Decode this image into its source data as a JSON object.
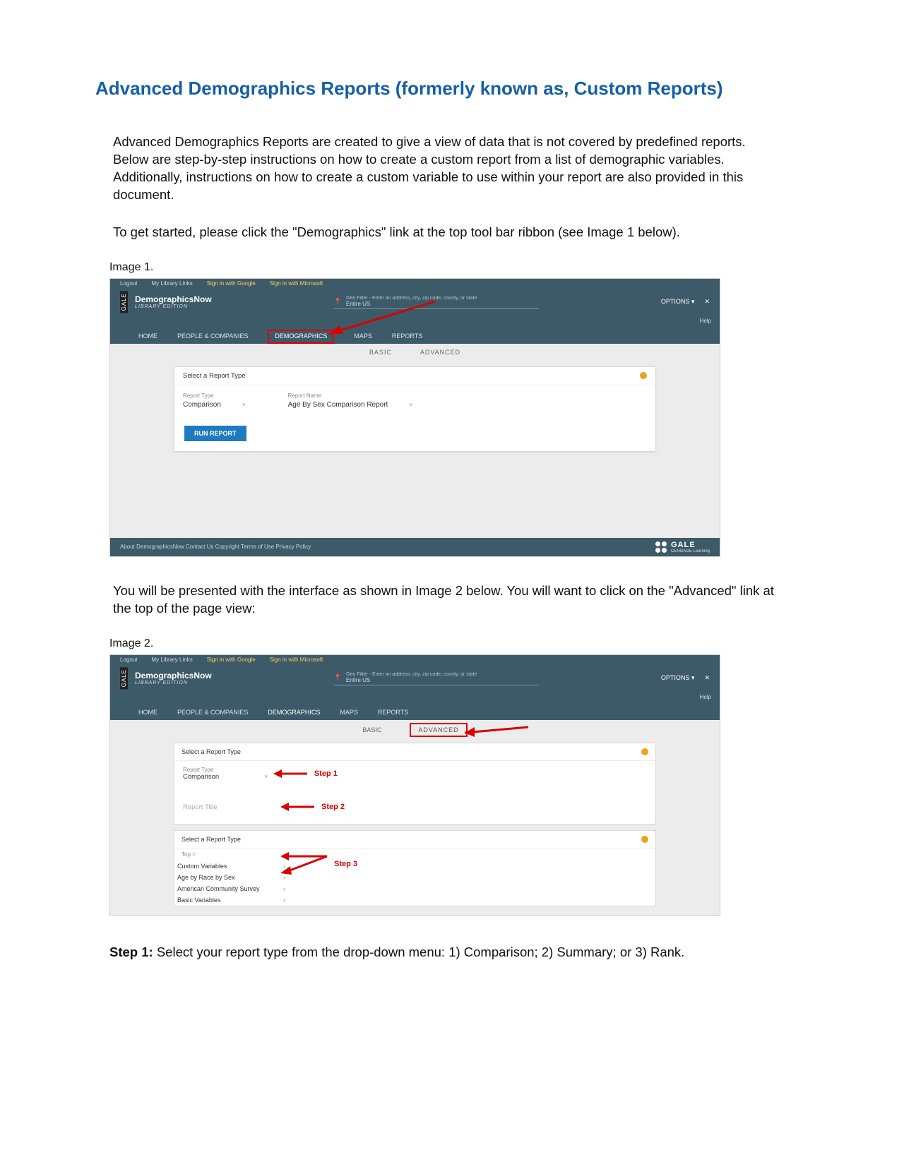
{
  "title": "Advanced Demographics Reports (formerly known as, Custom Reports)",
  "intro1": "Advanced Demographics Reports are created to give a view of data that is not covered by predefined reports. Below are step-by-step instructions on how to create a custom report from a list of demographic variables. Additionally, instructions on how to create a custom variable to use within your report are also provided in this document.",
  "intro2": "To get started, please click the \"Demographics\" link at the top tool bar ribbon (see Image 1 below).",
  "image1_label": "Image 1.",
  "shot1": {
    "topbar": {
      "logout": "Logout",
      "links": "My Library Links",
      "google": "Sign in with Google",
      "ms": "Sign in with Microsoft"
    },
    "brand": {
      "gale": "GALE",
      "name": "DemographicsNow",
      "edition": "LIBRARY EDITION"
    },
    "geo": {
      "hint": "Geo Filter - Enter an address, city, zip code, county, or state",
      "value": "Entire US"
    },
    "options": "OPTIONS ▾",
    "close": "✕",
    "help": "Help",
    "tabs": {
      "home": "HOME",
      "pc": "PEOPLE & COMPANIES",
      "demo": "DEMOGRAPHICS",
      "maps": "MAPS",
      "reports": "REPORTS"
    },
    "subtabs": {
      "basic": "BASIC",
      "advanced": "ADVANCED"
    },
    "panel": {
      "hdr": "Select a Report Type",
      "rt_label": "Report Type",
      "rt_value": "Comparison",
      "rn_label": "Report Name",
      "rn_value": "Age By Sex Comparison Report",
      "run": "RUN REPORT"
    },
    "footer": {
      "links": "About DemographicsNow    Contact Us    Copyright    Terms of Use    Privacy Policy",
      "gale": "GALE",
      "cengage": "CENGAGE Learning"
    }
  },
  "mid_para": "You will be presented with the interface as shown in Image 2 below.  You will want to click on the \"Advanced\" link at the top of the page view:",
  "image2_label": "Image 2.",
  "shot2": {
    "topbar": {
      "logout": "Logout",
      "links": "My Library Links",
      "google": "Sign in with Google",
      "ms": "Sign in with Microsoft"
    },
    "brand": {
      "gale": "GALE",
      "name": "DemographicsNow",
      "edition": "LIBRARY EDITION"
    },
    "geo": {
      "hint": "Geo Filter - Enter an address, city, zip code, county, or state",
      "value": "Entire US"
    },
    "options": "OPTIONS ▾",
    "close": "✕",
    "help": "Help",
    "tabs": {
      "home": "HOME",
      "pc": "PEOPLE & COMPANIES",
      "demo": "DEMOGRAPHICS",
      "maps": "MAPS",
      "reports": "REPORTS"
    },
    "subtabs": {
      "basic": "BASIC",
      "advanced": "ADVANCED"
    },
    "panelA": {
      "hdr": "Select a Report Type",
      "rt_label": "Report Type",
      "rt_value": "Comparison",
      "title_ph": "Report Title"
    },
    "steps": {
      "s1": "Step 1",
      "s2": "Step 2",
      "s3": "Step 3"
    },
    "panelB": {
      "hdr": "Select a Report Type",
      "top": "Top >",
      "items": [
        "Custom Variables",
        "Age by Race by Sex",
        "American Community Survey",
        "Basic Variables"
      ]
    }
  },
  "step1_bold": "Step 1:",
  "step1_rest": " Select your report type from the drop-down menu: 1) Comparison; 2) Summary; or 3) Rank."
}
